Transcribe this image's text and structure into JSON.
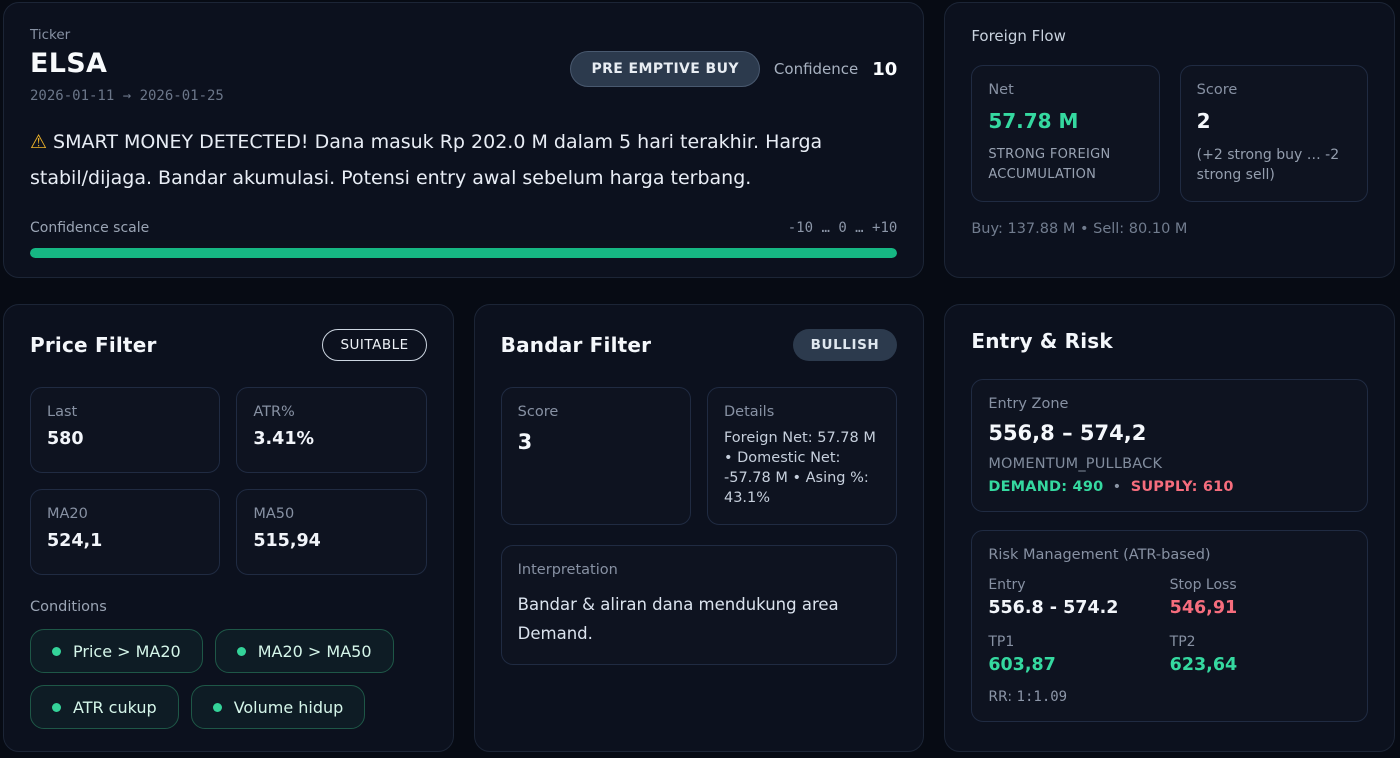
{
  "signal": {
    "ticker_label": "Ticker",
    "ticker": "ELSA",
    "date_range": "2026-01-11 → 2026-01-25",
    "recommendation_badge": "PRE EMPTIVE BUY",
    "confidence_label": "Confidence",
    "confidence_value": "10",
    "alert_icon": "⚠",
    "alert_text": "SMART MONEY DETECTED! Dana masuk Rp 202.0 M dalam 5 hari terakhir. Harga stabil/dijaga. Bandar akumulasi. Potensi entry awal sebelum harga terbang.",
    "scale_label": "Confidence scale",
    "scale_range": "-10 … 0 … +10",
    "scale_percent": 100,
    "scale_fill_style": "width:100%"
  },
  "foreign_flow": {
    "title": "Foreign Flow",
    "net_label": "Net",
    "net_value": "57.78 M",
    "net_desc": "STRONG FOREIGN ACCUMULATION",
    "score_label": "Score",
    "score_value": "2",
    "score_desc": "(+2 strong buy … -2 strong sell)",
    "footer": "Buy: 137.88 M • Sell: 80.10 M"
  },
  "price_filter": {
    "title": "Price Filter",
    "badge": "SUITABLE",
    "tiles": [
      {
        "label": "Last",
        "value": "580"
      },
      {
        "label": "ATR%",
        "value": "3.41%"
      },
      {
        "label": "MA20",
        "value": "524,1"
      },
      {
        "label": "MA50",
        "value": "515,94"
      }
    ],
    "conditions_label": "Conditions",
    "conditions": [
      "Price > MA20",
      "MA20 > MA50",
      "ATR cukup",
      "Volume hidup"
    ]
  },
  "bandar_filter": {
    "title": "Bandar Filter",
    "badge": "BULLISH",
    "score_label": "Score",
    "score_value": "3",
    "details_label": "Details",
    "details_text": "Foreign Net: 57.78 M • Domestic Net: -57.78 M • Asing %: 43.1%",
    "interpretation_label": "Interpretation",
    "interpretation_text": "Bandar & aliran dana mendukung area Demand."
  },
  "entry_risk": {
    "title": "Entry & Risk",
    "entry_zone_label": "Entry Zone",
    "entry_zone_value": "556,8 – 574,2",
    "strategy": "MOMENTUM_PULLBACK",
    "demand_label": "DEMAND:",
    "demand_value": "490",
    "separator": "•",
    "supply_label": "SUPPLY:",
    "supply_value": "610",
    "risk_title": "Risk Management (ATR-based)",
    "entry_label": "Entry",
    "entry_value": "556.8 - 574.2",
    "stop_label": "Stop Loss",
    "stop_value": "546,91",
    "tp1_label": "TP1",
    "tp1_value": "603,87",
    "tp2_label": "TP2",
    "tp2_value": "623,64",
    "rr_label": "RR:",
    "rr_value": "1:1.09"
  },
  "colors": {
    "value_green": "#35d9a0",
    "bar_green": "#16b783",
    "rose_red": "#f66d7d",
    "warning_amber": "#f0b429",
    "card_bg": "#0c111e",
    "page_bg": "#070b14"
  }
}
